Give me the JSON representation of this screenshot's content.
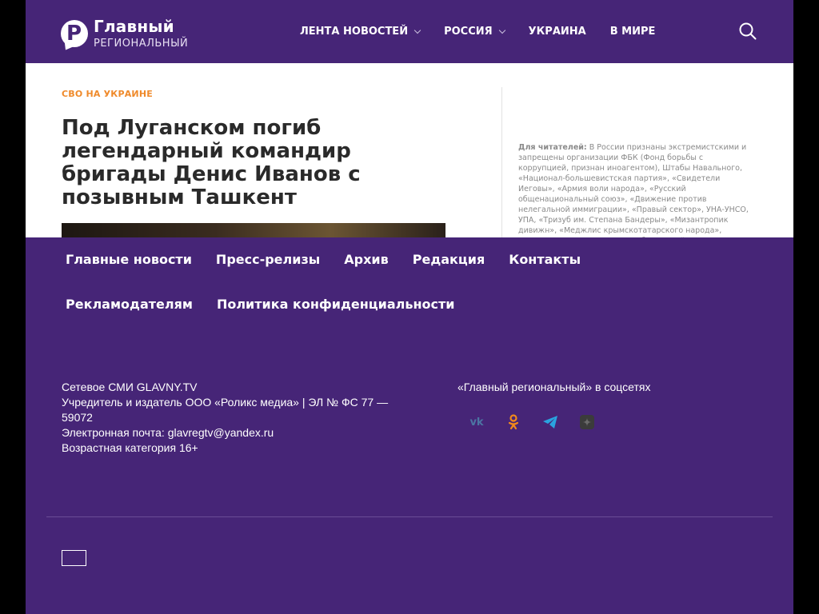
{
  "logo": {
    "line1": "Главный",
    "line2": "РЕГИОНАЛЬНЫЙ"
  },
  "nav": [
    {
      "label": "ЛЕНТА НОВОСТЕЙ",
      "dropdown": true
    },
    {
      "label": "РОССИЯ",
      "dropdown": true
    },
    {
      "label": "УКРАИНА",
      "dropdown": false
    },
    {
      "label": "В МИРЕ",
      "dropdown": false
    }
  ],
  "article": {
    "category": "СВО НА УКРАИНЕ",
    "title": "Под Луганском погиб легендарный командир бригады Денис Иванов с позывным Ташкент"
  },
  "notice": {
    "label": "Для читателей:",
    "text": " В России признаны экстремистскими и запрещены организации ФБК (Фонд борьбы с коррупцией, признан иноагентом), Штабы Навального, «Национал-большевистская партия», «Свидетели Иеговы», «Армия воли народа», «Русский общенациональный союз», «Движение против нелегальной иммиграции», «Правый сектор», УНА-УНСО, УПА, «Тризуб им. Степана Бандеры», «Мизантропик дивижн», «Меджлис крымскотатарского народа», движение «Артподготовка», общероссийская политическая партия"
  },
  "footer": {
    "links": [
      "Главные новости",
      "Пресс-релизы",
      "Архив",
      "Редакция",
      "Контакты",
      "Рекламодателям",
      "Политика конфиденциальности"
    ],
    "info": [
      "Сетевое СМИ GLAVNY.TV",
      "Учредитель и издатель ООО «Роликс медиа» | ЭЛ № ФС 77 — 59072",
      "Электронная почта: glavregtv@yandex.ru",
      "Возрастная категория 16+"
    ],
    "social_title": "«Главный региональный» в соцсетях",
    "social_icons": [
      "vk-icon",
      "odnoklassniki-icon",
      "telegram-icon",
      "dzen-icon"
    ]
  },
  "colors": {
    "brand": "#462577",
    "accent": "#ef8a2b",
    "text": "#2a2a2a"
  }
}
